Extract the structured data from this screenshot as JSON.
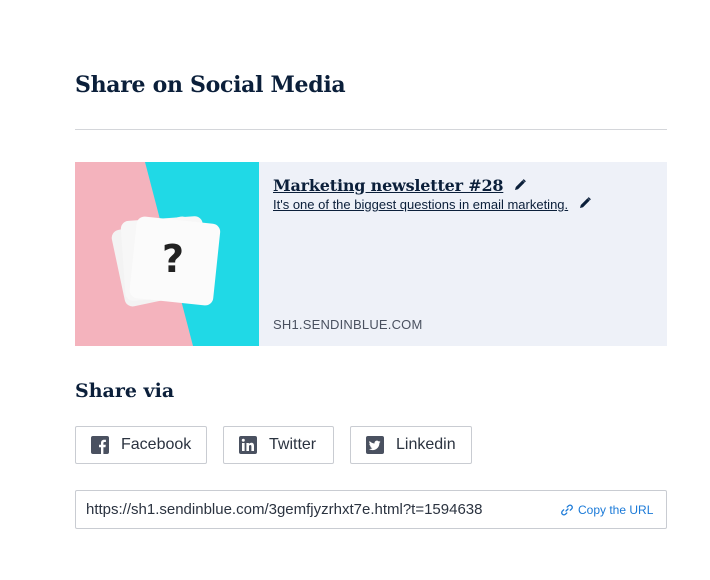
{
  "header": {
    "title": "Share on Social Media"
  },
  "preview": {
    "title": "Marketing newsletter #28",
    "description": "It's one of the biggest questions in email marketing.",
    "domain": "SH1.SENDINBLUE.COM",
    "image_glyph": "?",
    "colors": {
      "background": "#eef1f8",
      "thumb_pink": "#f4b3bd",
      "thumb_cyan": "#20d9e6"
    }
  },
  "share": {
    "heading": "Share via",
    "buttons": [
      {
        "label": "Facebook",
        "icon": "facebook-icon"
      },
      {
        "label": "Twitter",
        "icon": "linkedin-icon"
      },
      {
        "label": "Linkedin",
        "icon": "twitter-icon"
      }
    ]
  },
  "url_field": {
    "value": "https://sh1.sendinblue.com/3gemfjyzrhxt7e.html?t=1594638",
    "copy_label": "Copy the URL",
    "copy_icon": "link-icon"
  },
  "theme": {
    "accent": "#1b7ad8",
    "heading_color": "#0b1f3a",
    "icon_color": "#4a5160"
  }
}
